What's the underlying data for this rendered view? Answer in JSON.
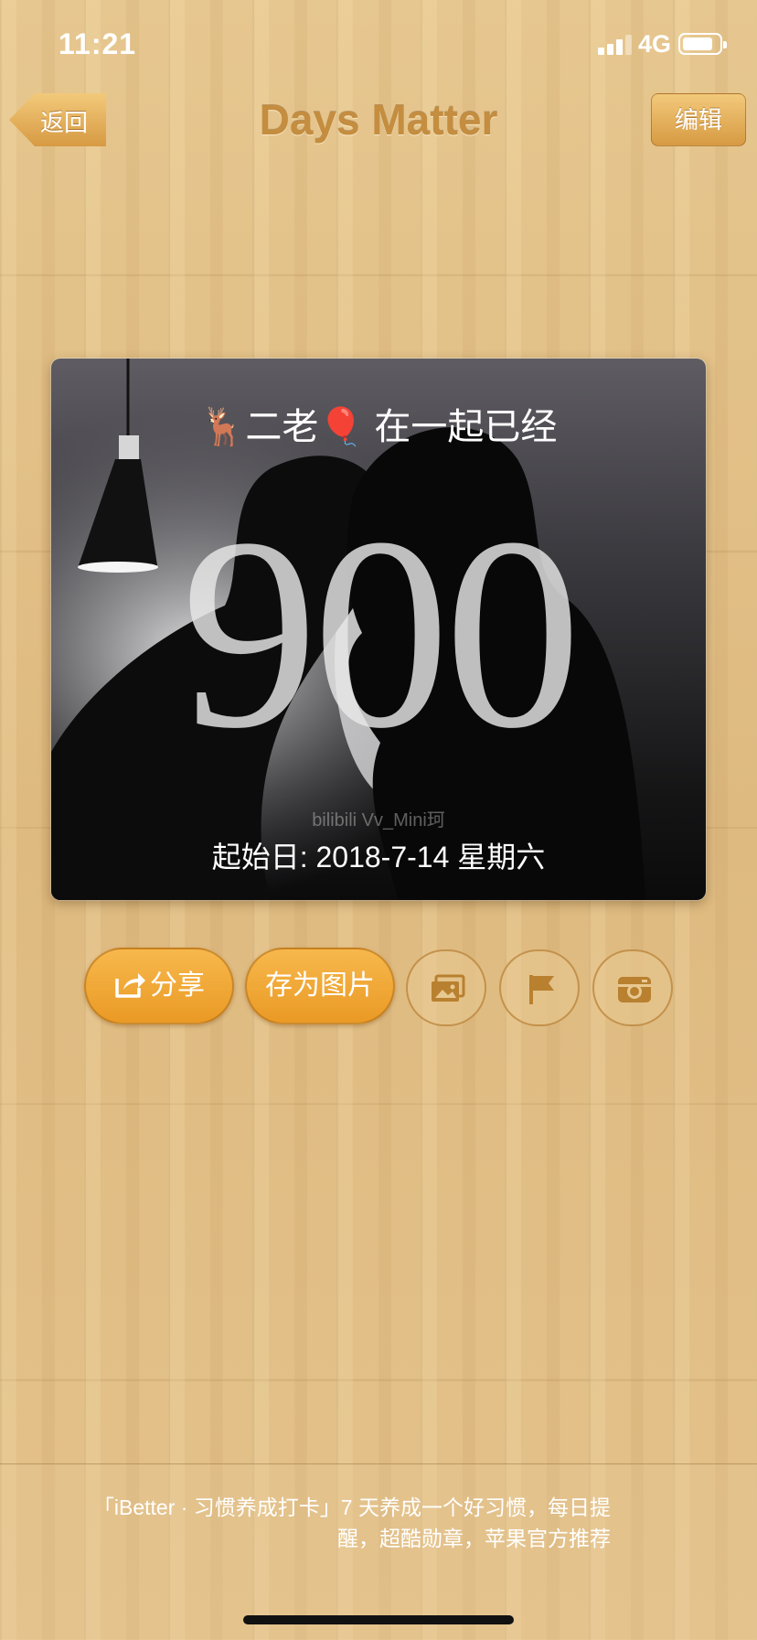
{
  "status_bar": {
    "time": "11:21",
    "network": "4G",
    "signal_bars": 3,
    "battery_level": 0.85
  },
  "nav": {
    "title": "Days Matter",
    "back_label": "返回",
    "edit_label": "编辑"
  },
  "card": {
    "title": "🦌二老🎈 在一起已经",
    "count": "900",
    "watermark": "bilibili  Vv_Mini珂",
    "start_date": "起始日: 2018-7-14 星期六"
  },
  "actions": {
    "share_label": "分享",
    "save_label": "存为图片",
    "icons": [
      "share-icon",
      "photos-icon",
      "flag-icon",
      "camera-icon"
    ]
  },
  "ad": {
    "text": "「iBetter · 习惯养成打卡」7 天养成一个好习惯，每日提醒，超酷勋章，苹果官方推荐"
  },
  "colors": {
    "accent": "#ea9a25",
    "title": "#c48d3f",
    "wood": "#e2bf86"
  }
}
